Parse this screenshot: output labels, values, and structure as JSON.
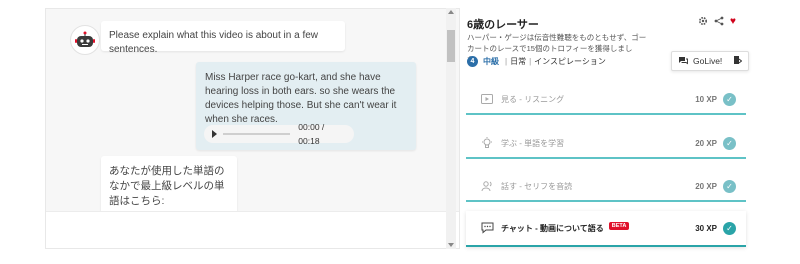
{
  "chat": {
    "question": "Please explain what this video is about in a few sentences.",
    "user_reply": "Miss Harper race go-kart, and she have hearing loss in both ears. so she wears the devices helping those. But she can't wear it when she races.",
    "audio_time": "00:00 / 00:18",
    "bot_reply": "あなたが使用した単語のなかで最上級レベルの単語はこちら:"
  },
  "lesson": {
    "title": "6歳のレーサー",
    "description": "ハーパー・ゲージは伝音性難聴をものともせず、ゴーカートのレースで15個のトロフィーを獲得しました。",
    "level_number": "4",
    "level_label": "中級",
    "category": "日常",
    "tag": "インスピレーション",
    "golive_label": "GoLive!"
  },
  "icons": {
    "settings": "gear-icon",
    "share": "share-icon",
    "favorite": "heart-icon",
    "favorite_color": "#d0021b"
  },
  "steps": [
    {
      "label": "見る - リスニング",
      "xp": "10 XP",
      "icon": "video-icon"
    },
    {
      "label": "学ぶ - 単語を学習",
      "xp": "20 XP",
      "icon": "lightbulb-icon"
    },
    {
      "label": "話す - セリフを音読",
      "xp": "20 XP",
      "icon": "speak-icon"
    },
    {
      "label": "チャット - 動画について語る",
      "xp": "30 XP",
      "icon": "chat-icon",
      "badge": "BETA"
    }
  ],
  "colors": {
    "accent": "#2aa4a8",
    "level": "#2b6ea8",
    "beta": "#e0112b"
  }
}
